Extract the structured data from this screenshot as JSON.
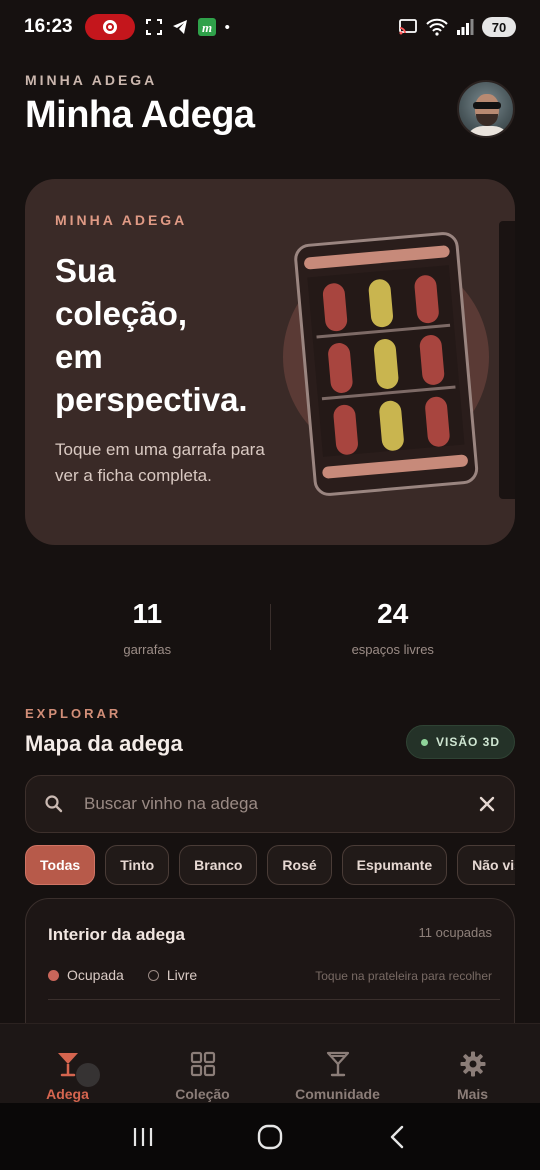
{
  "status_bar": {
    "time": "16:23",
    "battery": "70",
    "icons": [
      "record-icon",
      "screenshot-icon",
      "telegram-icon",
      "app-m-icon",
      "dot-icon",
      "cast-icon",
      "wifi-icon",
      "signal-icon"
    ]
  },
  "header": {
    "overline": "MINHA ADEGA",
    "title": "Minha Adega"
  },
  "hero": {
    "overline": "MINHA ADEGA",
    "title": "Sua\ncoleção,\nem\nperspectiva.",
    "subtitle": "Toque em uma garrafa para ver a ficha completa."
  },
  "stats": [
    {
      "value": "11",
      "label": "garrafas"
    },
    {
      "value": "24",
      "label": "espaços livres"
    }
  ],
  "explore": {
    "overline": "EXPLORAR",
    "title": "Mapa da adega",
    "view_button": "VISÃO 3D"
  },
  "search": {
    "placeholder": "Buscar vinho na adega",
    "value": ""
  },
  "filters": [
    "Todas",
    "Tinto",
    "Branco",
    "Rosé",
    "Espumante",
    "Não visível"
  ],
  "interior": {
    "title": "Interior da adega",
    "count": "11 ocupadas",
    "legend_occupied": "Ocupada",
    "legend_free": "Livre",
    "hint": "Toque na prateleira para recolher"
  },
  "bottom_nav": [
    {
      "label": "Adega",
      "icon": "wine-glass-icon",
      "active": true
    },
    {
      "label": "Coleção",
      "icon": "grid-icon",
      "active": false
    },
    {
      "label": "Comunidade",
      "icon": "cocktail-icon",
      "active": false
    },
    {
      "label": "Mais",
      "icon": "gear-icon",
      "active": false
    }
  ],
  "colors": {
    "accent": "#d5654f",
    "hero_bg": "#3a2a27",
    "page_bg": "#161110",
    "bottle_red": "#a8453f",
    "bottle_yellow": "#c9b54f"
  }
}
